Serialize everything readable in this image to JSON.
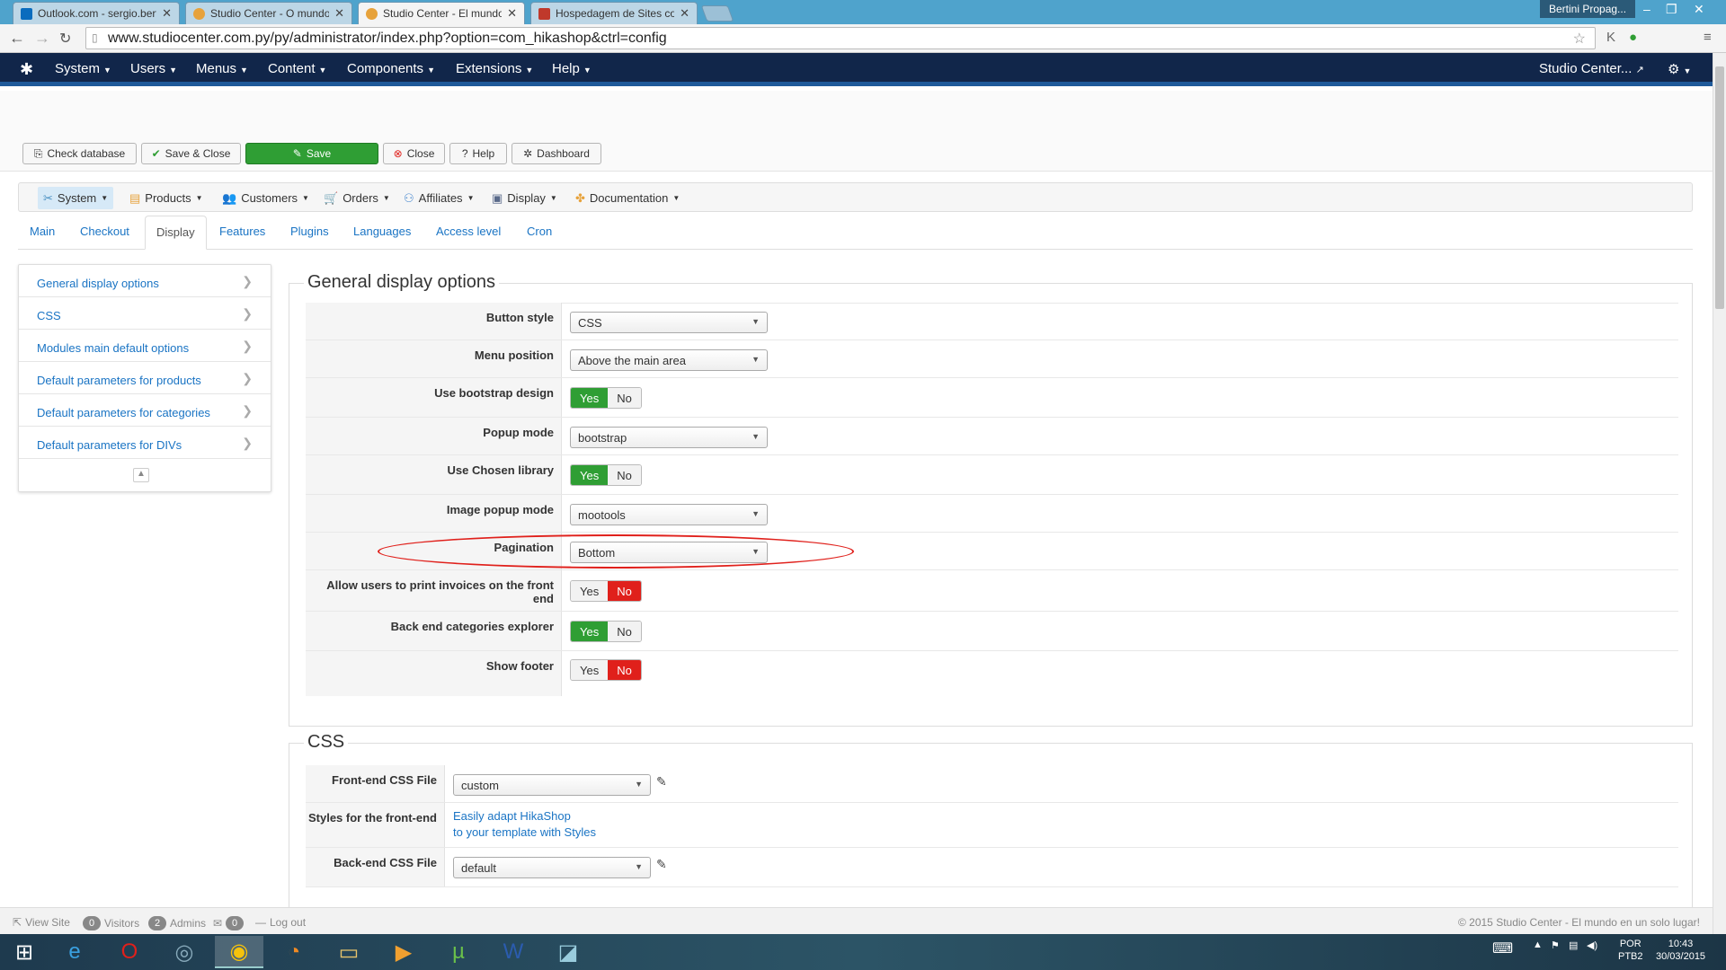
{
  "browser": {
    "tabs": [
      {
        "title": "Outlook.com - sergio.bert",
        "fav": "#0a6cbe"
      },
      {
        "title": "Studio Center - O mundo",
        "fav": "#e7a23b"
      },
      {
        "title": "Studio Center - El mundo",
        "fav": "#e7a23b"
      },
      {
        "title": "Hospedagem de Sites con",
        "fav": "#c0392b"
      }
    ],
    "profile": "Bertini Propag...",
    "url": "www.studiocenter.com.py/py/administrator/index.php?option=com_hikashop&ctrl=config"
  },
  "topnav": {
    "items": [
      "System",
      "Users",
      "Menus",
      "Content",
      "Components",
      "Extensions",
      "Help"
    ],
    "site": "Studio Center..."
  },
  "toolbar": {
    "check_db": "Check database",
    "save_close": "Save & Close",
    "save": "Save",
    "close": "Close",
    "help": "Help",
    "dashboard": "Dashboard"
  },
  "hika_menu": [
    "System",
    "Products",
    "Customers",
    "Orders",
    "Affiliates",
    "Display",
    "Documentation"
  ],
  "tabs": [
    "Main",
    "Checkout",
    "Display",
    "Features",
    "Plugins",
    "Languages",
    "Access level",
    "Cron"
  ],
  "left_list": [
    "General display options",
    "CSS",
    "Modules main default options",
    "Default parameters for products",
    "Default parameters for categories",
    "Default parameters for DIVs"
  ],
  "general": {
    "legend": "General display options",
    "rows": [
      {
        "label": "Button style",
        "type": "select",
        "value": "CSS"
      },
      {
        "label": "Menu position",
        "type": "select",
        "value": "Above the main area"
      },
      {
        "label": "Use bootstrap design",
        "type": "yn",
        "value": "Yes"
      },
      {
        "label": "Popup mode",
        "type": "select",
        "value": "bootstrap"
      },
      {
        "label": "Use Chosen library",
        "type": "yn",
        "value": "Yes"
      },
      {
        "label": "Image popup mode",
        "type": "select",
        "value": "mootools"
      },
      {
        "label": "Pagination",
        "type": "select",
        "value": "Bottom"
      },
      {
        "label": "Allow users to print invoices on the front end",
        "type": "yn",
        "value": "No"
      },
      {
        "label": "Back end categories explorer",
        "type": "yn",
        "value": "Yes"
      },
      {
        "label": "Show footer",
        "type": "yn",
        "value": "No"
      }
    ],
    "yes_label": "Yes",
    "no_label": "No"
  },
  "css": {
    "legend": "CSS",
    "frontend_label": "Front-end CSS File",
    "frontend_value": "custom",
    "styles_label": "Styles for the front-end",
    "styles_link_1": "Easily adapt HikaShop",
    "styles_link_2": "to your template with Styles",
    "backend_label": "Back-end CSS File",
    "backend_value": "default"
  },
  "statusbar": {
    "view_site": "View Site",
    "visitors_count": "0",
    "visitors": "Visitors",
    "admins_count": "2",
    "admins": "Admins",
    "msg_count": "0",
    "logout": "Log out",
    "copyright": "© 2015 Studio Center - El mundo en un solo lugar!"
  },
  "taskbar": {
    "lang1": "POR",
    "lang2": "PTB2",
    "time": "10:43",
    "date": "30/03/2015"
  }
}
